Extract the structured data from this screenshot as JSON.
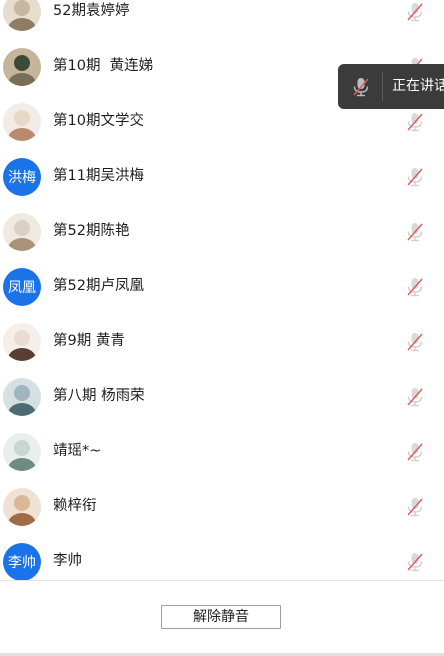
{
  "participants": [
    {
      "name": "52期袁婷婷",
      "avatar_type": "photo",
      "avatar_palette": [
        "#c8b79f",
        "#8d7c66",
        "#e7ddcd"
      ],
      "muted": true
    },
    {
      "name": "第10期  黄连娣",
      "avatar_type": "photo",
      "avatar_palette": [
        "#3d4a3a",
        "#7a6d55",
        "#c4b59b"
      ],
      "muted": true
    },
    {
      "name": "第10期文学交",
      "avatar_type": "photo",
      "avatar_palette": [
        "#e8d8c8",
        "#b98a6d",
        "#f3ece6"
      ],
      "muted": true
    },
    {
      "name": "第11期吴洪梅",
      "avatar_type": "text",
      "avatar_text": "洪梅",
      "muted": true
    },
    {
      "name": "第52期陈艳",
      "avatar_type": "photo",
      "avatar_palette": [
        "#d9d1c4",
        "#a89278",
        "#efe9df"
      ],
      "muted": true
    },
    {
      "name": "第52期卢凤凰",
      "avatar_type": "text",
      "avatar_text": "凤凰",
      "muted": true
    },
    {
      "name": "第9期 黄青",
      "avatar_type": "photo",
      "avatar_palette": [
        "#eadcd4",
        "#5a3d33",
        "#f6eee9"
      ],
      "muted": true
    },
    {
      "name": "第八期 杨雨荣",
      "avatar_type": "photo",
      "avatar_palette": [
        "#9fb5bf",
        "#4e6b74",
        "#d5e0e3"
      ],
      "muted": true
    },
    {
      "name": "靖瑶*~",
      "avatar_type": "photo",
      "avatar_palette": [
        "#c9d6d0",
        "#6f8a7f",
        "#e9efec"
      ],
      "muted": true
    },
    {
      "name": "赖梓衔",
      "avatar_type": "photo",
      "avatar_palette": [
        "#d9b898",
        "#a06c48",
        "#f0e2d3"
      ],
      "muted": true
    },
    {
      "name": "李帅",
      "avatar_type": "text",
      "avatar_text": "李帅",
      "muted": true
    }
  ],
  "footer": {
    "unmute_label": "解除静音"
  },
  "toast": {
    "text": "正在讲话"
  },
  "icons": {
    "mic_muted": "mic-muted-icon"
  },
  "colors": {
    "avatar_blue": "#1a73e8",
    "mute_red": "#e05a5a",
    "toast_bg": "#3b3b3b"
  }
}
